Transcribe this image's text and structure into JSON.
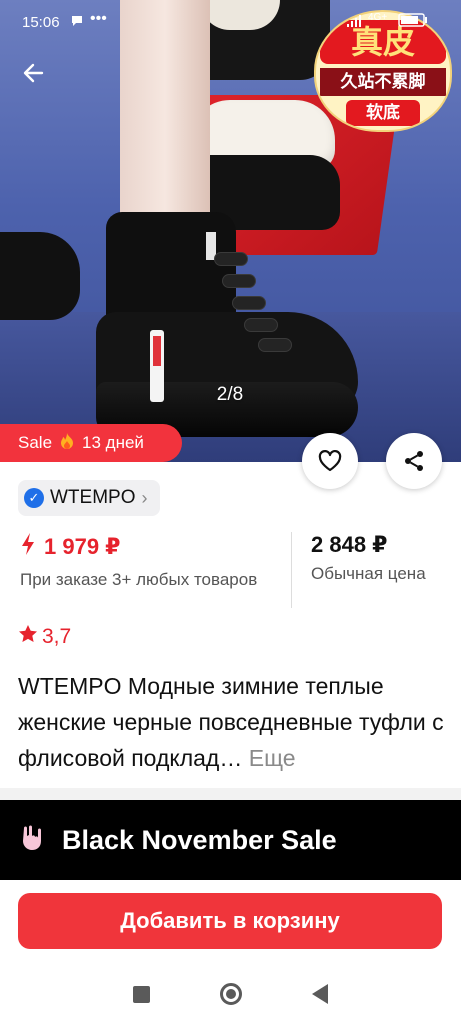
{
  "status_bar": {
    "time": "15:06",
    "icons": [
      "message-icon",
      "more-dots-icon",
      "signal-icon",
      "lte-icon",
      "battery-icon"
    ],
    "battery": "76"
  },
  "gallery": {
    "counter": "2/8",
    "promo": {
      "line1": "真皮",
      "line2": "久站不累脚",
      "line3": "软底"
    }
  },
  "sale_badge": {
    "label": "Sale",
    "icon": "fire-icon",
    "days": "13 дней"
  },
  "brand": {
    "name": "WTEMPO",
    "verified": true
  },
  "price": {
    "discounted": "1 979 ₽",
    "discount_note": "При заказе 3+ любых товаров",
    "regular": "2 848 ₽",
    "regular_label": "Обычная цена"
  },
  "rating": {
    "value": "3,7"
  },
  "product": {
    "title": "WTEMPO Модные зимние теплые женские черные повседневные туфли с флисовой подклад…",
    "more_label": "Еще"
  },
  "banner": {
    "text": "Black November Sale"
  },
  "actions": {
    "add_to_cart": "Добавить в корзину"
  },
  "colors": {
    "accent": "#f0353b",
    "price_red": "#e6232d",
    "verified_blue": "#1f6fe8"
  }
}
